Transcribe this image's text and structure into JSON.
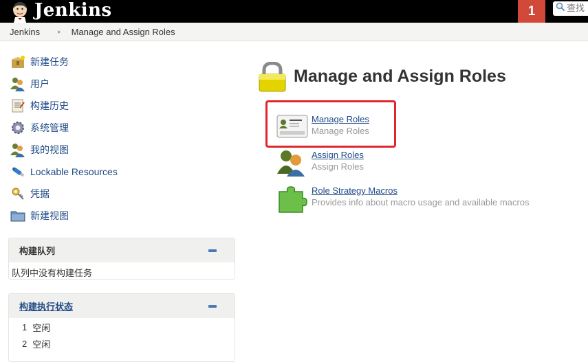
{
  "header": {
    "logo_text": "Jenkins",
    "notification_count": "1",
    "search_placeholder": "查找",
    "logo_icon": "jenkins-butler-icon"
  },
  "breadcrumb": {
    "items": [
      "Jenkins",
      "Manage and Assign Roles"
    ]
  },
  "sidebar": {
    "tasks": [
      {
        "label": "新建任务",
        "icon": "new-job-icon"
      },
      {
        "label": "用户",
        "icon": "users-icon"
      },
      {
        "label": "构建历史",
        "icon": "history-icon"
      },
      {
        "label": "系统管理",
        "icon": "gear-icon"
      },
      {
        "label": "我的视图",
        "icon": "users-icon"
      },
      {
        "label": "Lockable Resources",
        "icon": "usb-icon"
      },
      {
        "label": "凭据",
        "icon": "credentials-icon"
      },
      {
        "label": "新建视图",
        "icon": "folder-icon"
      }
    ]
  },
  "build_queue": {
    "title": "构建队列",
    "empty_text": "队列中没有构建任务"
  },
  "executors": {
    "title": "构建执行状态",
    "rows": [
      {
        "num": "1",
        "status": "空闲"
      },
      {
        "num": "2",
        "status": "空闲"
      }
    ]
  },
  "main": {
    "title": "Manage and Assign Roles",
    "entries": [
      {
        "link": "Manage Roles",
        "desc": "Manage Roles",
        "icon": "id-card-icon"
      },
      {
        "link": "Assign Roles",
        "desc": "Assign Roles",
        "icon": "users-icon"
      },
      {
        "link": "Role Strategy Macros",
        "desc": "Provides info about macro usage and available macros",
        "icon": "puzzle-icon"
      }
    ]
  },
  "colors": {
    "header_bg": "#000000",
    "badge_bg": "#d24939",
    "link": "#204a87",
    "highlight": "#e0262c"
  }
}
